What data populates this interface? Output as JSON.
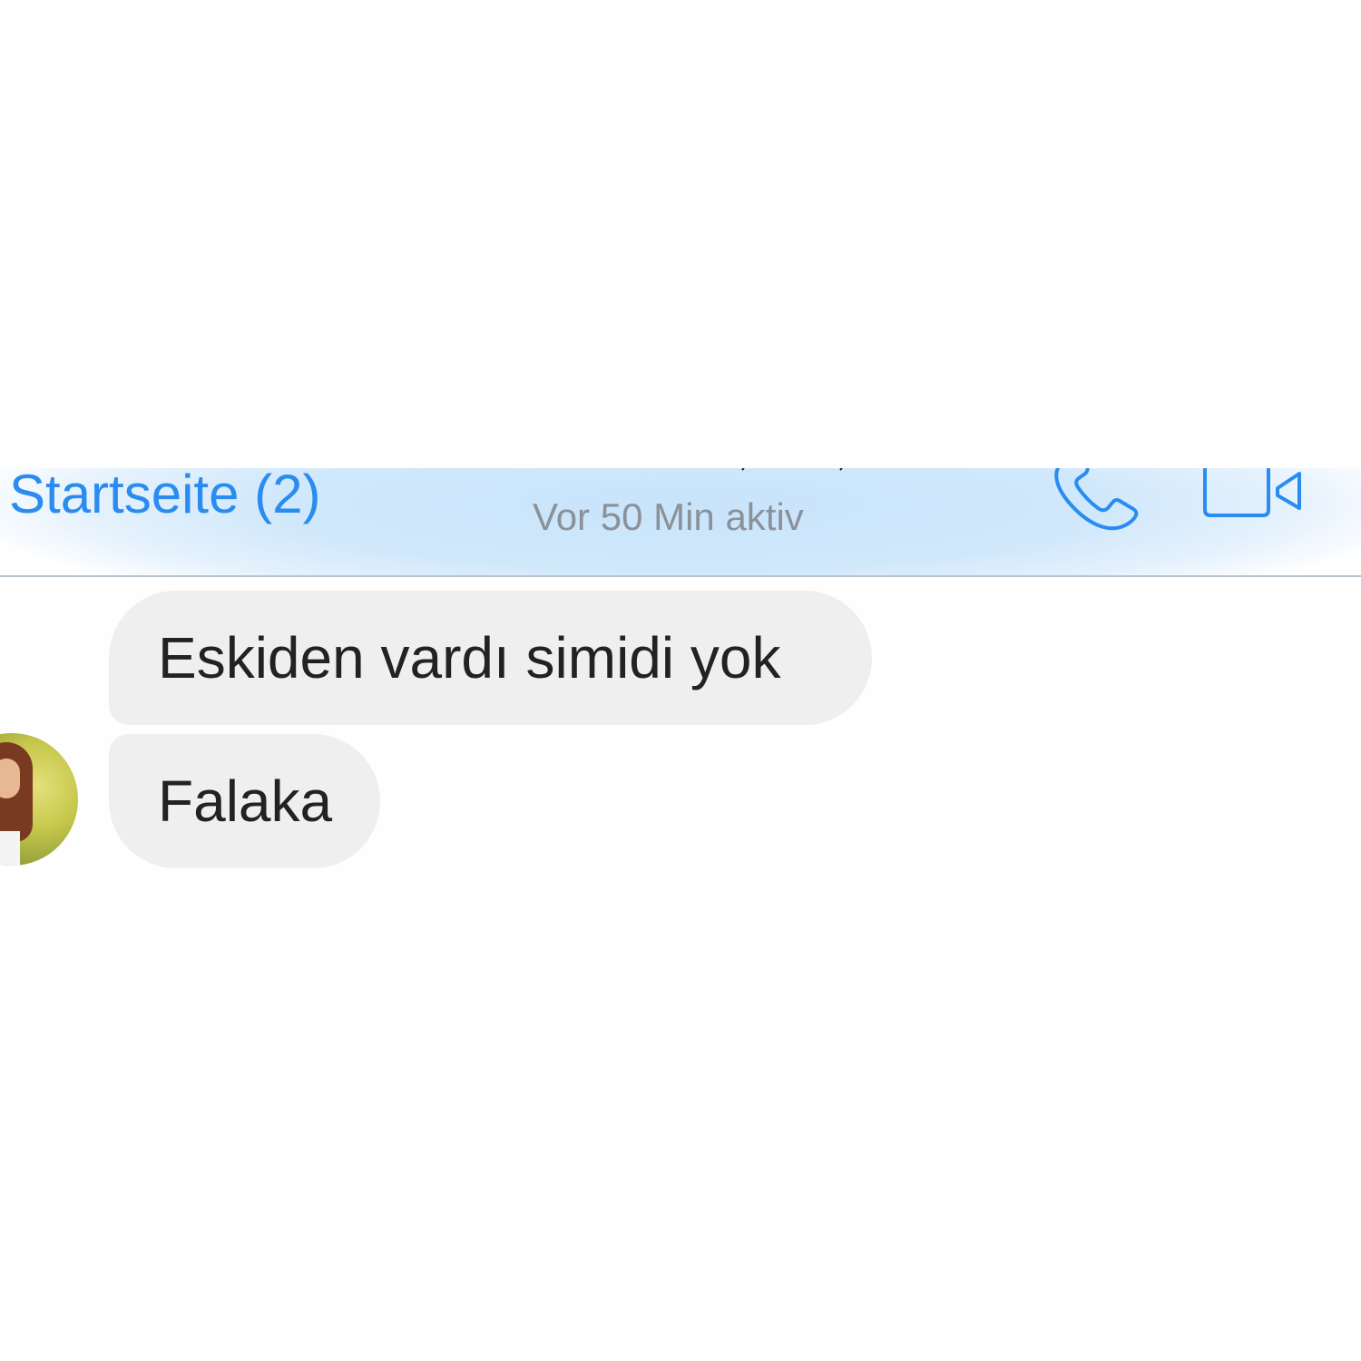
{
  "nav": {
    "back_label": "Startseite (2)",
    "status": "Vor 50 Min aktiv",
    "accent_color": "#2a8cf0",
    "icons": [
      "phone-icon",
      "video-camera-icon"
    ]
  },
  "messages": [
    {
      "text": "Eskiden vardı simidi yok"
    },
    {
      "text": "Falaka"
    }
  ],
  "colors": {
    "bubble_background": "#efefef",
    "nav_background": "#cfe7fb",
    "status_text": "#8b9198"
  }
}
